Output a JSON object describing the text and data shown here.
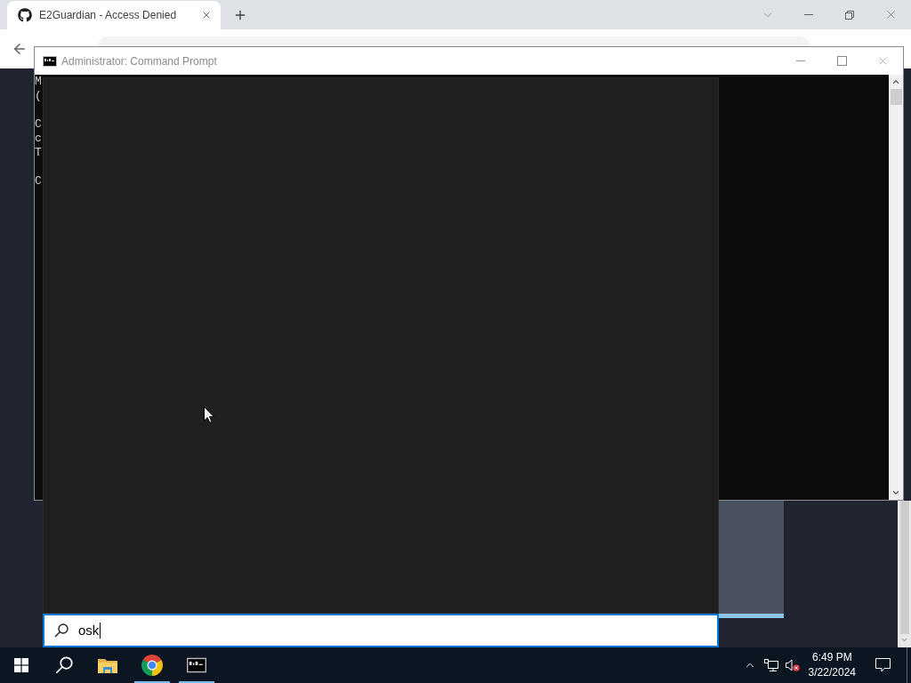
{
  "browser": {
    "tabs": [
      {
        "title": "E2Guardian - Access Denied",
        "selected": true
      }
    ]
  },
  "console_window": {
    "title": "Administrator: Command Prompt",
    "paragraphs": [
      [
        "M",
        "("
      ],
      [
        "C",
        "c",
        "T"
      ],
      [
        "C"
      ]
    ]
  },
  "search": {
    "value": "osk"
  },
  "taskbar": {
    "apps": [
      {
        "kind": "explorer",
        "running": false
      },
      {
        "kind": "chrome",
        "running": true
      },
      {
        "kind": "console",
        "running": true
      }
    ],
    "clock": {
      "time": "6:49 PM",
      "date": "3/22/2024"
    }
  }
}
